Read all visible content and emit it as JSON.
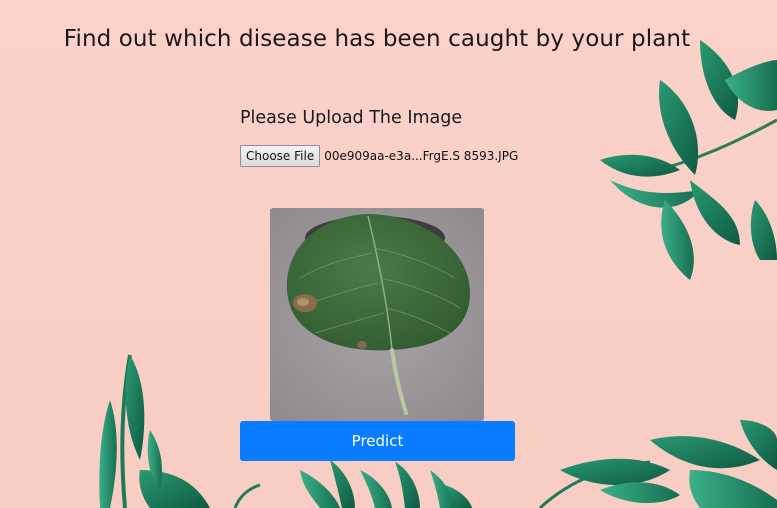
{
  "header": {
    "title": "Find out which disease has been caught by your plant"
  },
  "upload": {
    "label": "Please Upload The Image",
    "choose_button_label": "Choose File",
    "selected_file_name": "00e909aa-e3a...FrgE.S 8593.JPG"
  },
  "preview": {
    "subject": "leaf-image"
  },
  "actions": {
    "predict_label": "Predict"
  },
  "colors": {
    "background": "#f9cfc6",
    "accent": "#0a7cff",
    "foliage": "#1f7a5a"
  }
}
